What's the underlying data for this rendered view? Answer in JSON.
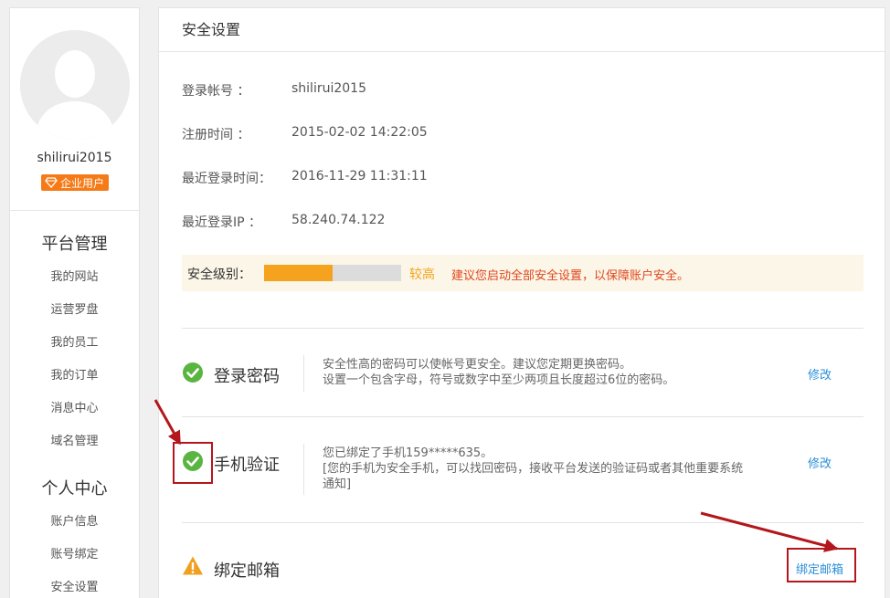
{
  "user": {
    "username": "shilirui2015",
    "badge": "企业用户"
  },
  "sidebar": {
    "sections": [
      {
        "title": "平台管理",
        "items": [
          "我的网站",
          "运营罗盘",
          "我的员工",
          "我的订单",
          "消息中心",
          "域名管理"
        ]
      },
      {
        "title": "个人中心",
        "items": [
          "账户信息",
          "账号绑定",
          "安全设置"
        ]
      }
    ]
  },
  "main": {
    "title": "安全设置",
    "info": [
      {
        "label": "登录帐号 ：",
        "value": "shilirui2015"
      },
      {
        "label": "注册时间 ：",
        "value": "2015-02-02 14:22:05"
      },
      {
        "label": "最近登录时间：",
        "value": "2016-11-29 11:31:11"
      },
      {
        "label": "最近登录IP ：",
        "value": "58.240.74.122"
      }
    ],
    "security_level": {
      "label": "安全级别：",
      "fill_fraction": 0.5,
      "level_text": "较高",
      "tip": "建议您启动全部安全设置，以保障账户安全。",
      "fill_color": "#f5a31e",
      "tip_color": "#e0461c"
    },
    "rows": [
      {
        "icon": "check-circle-icon",
        "title": "登录密码",
        "desc_lines": [
          "安全性高的密码可以使帐号更安全。建议您定期更换密码。",
          "设置一个包含字母，符号或数字中至少两项且长度超过6位的密码。"
        ],
        "action": "修改"
      },
      {
        "icon": "check-circle-icon",
        "title": "手机验证",
        "desc_lines": [
          "您已绑定了手机159*****635。",
          "[您的手机为安全手机，可以找回密码，接收平台发送的验证码或者其他重要系统",
          "通知]"
        ],
        "action": "修改"
      },
      {
        "icon": "warning-triangle-icon",
        "title": "绑定邮箱",
        "desc_lines": [],
        "action": "绑定邮箱"
      }
    ]
  },
  "colors": {
    "success": "#5ab540",
    "warning": "#f0a020",
    "link": "#2a8fd8",
    "annotation": "#b3161b"
  }
}
